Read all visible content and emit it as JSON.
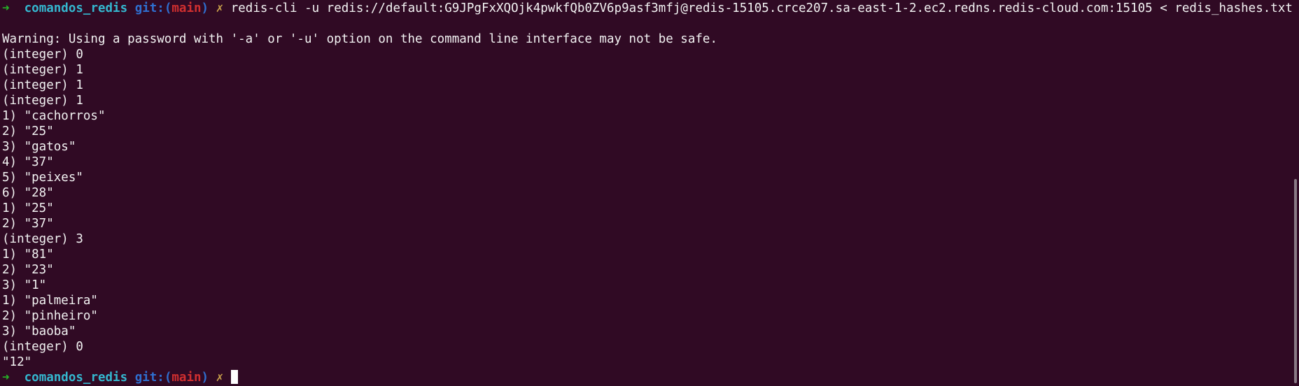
{
  "prompt1": {
    "arrow": "➜",
    "dir": "comandos_redis",
    "git_prefix": "git:(",
    "branch": "main",
    "git_suffix": ")",
    "dirty": "✗",
    "command": "redis-cli -u redis://default:G9JPgFxXQOjk4pwkfQb0ZV6p9asf3mfj@redis-15105.crce207.sa-east-1-2.ec2.redns.redis-cloud.com:15105 < redis_hashes.txt"
  },
  "output": [
    "Warning: Using a password with '-a' or '-u' option on the command line interface may not be safe.",
    "(integer) 0",
    "(integer) 1",
    "(integer) 1",
    "(integer) 1",
    "1) \"cachorros\"",
    "2) \"25\"",
    "3) \"gatos\"",
    "4) \"37\"",
    "5) \"peixes\"",
    "6) \"28\"",
    "1) \"25\"",
    "2) \"37\"",
    "(integer) 3",
    "1) \"81\"",
    "2) \"23\"",
    "3) \"1\"",
    "1) \"palmeira\"",
    "2) \"pinheiro\"",
    "3) \"baoba\"",
    "(integer) 0",
    "\"12\""
  ],
  "prompt2": {
    "arrow": "➜",
    "dir": "comandos_redis",
    "git_prefix": "git:(",
    "branch": "main",
    "git_suffix": ")",
    "dirty": "✗"
  },
  "colors": {
    "background": "#300a24",
    "arrow": "#26b426",
    "dir": "#34b7cf",
    "git": "#2f6fd0",
    "branch": "#d02f2f",
    "dirty": "#c8a04a"
  }
}
